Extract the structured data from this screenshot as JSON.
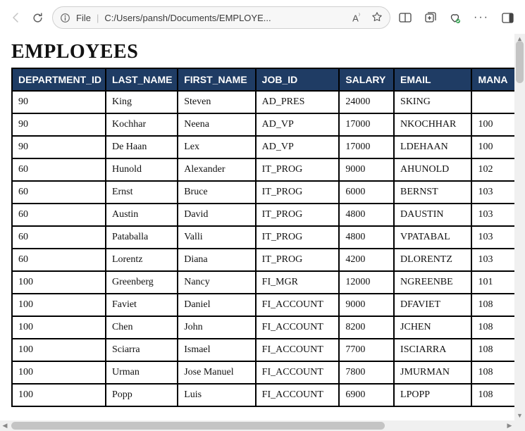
{
  "addressbar": {
    "scheme": "File",
    "url": "C:/Users/pansh/Documents/EMPLOYE...",
    "read_aloud": "A⁾"
  },
  "page": {
    "title": "EMPLOYEES"
  },
  "table": {
    "columns": [
      "DEPARTMENT_ID",
      "LAST_NAME",
      "FIRST_NAME",
      "JOB_ID",
      "SALARY",
      "EMAIL",
      "MANAGER_ID"
    ],
    "columns_cut": [
      "DEPARTMENT_ID",
      "LAST_NAME",
      "FIRST_NAME",
      "JOB_ID",
      "SALARY",
      "EMAIL",
      "MANA"
    ],
    "rows": [
      {
        "department_id": "90",
        "last_name": "King",
        "first_name": "Steven",
        "job_id": "AD_PRES",
        "salary": "24000",
        "email": "SKING",
        "manager_id": ""
      },
      {
        "department_id": "90",
        "last_name": "Kochhar",
        "first_name": "Neena",
        "job_id": "AD_VP",
        "salary": "17000",
        "email": "NKOCHHAR",
        "manager_id": "100"
      },
      {
        "department_id": "90",
        "last_name": "De Haan",
        "first_name": "Lex",
        "job_id": "AD_VP",
        "salary": "17000",
        "email": "LDEHAAN",
        "manager_id": "100"
      },
      {
        "department_id": "60",
        "last_name": "Hunold",
        "first_name": "Alexander",
        "job_id": "IT_PROG",
        "salary": "9000",
        "email": "AHUNOLD",
        "manager_id": "102"
      },
      {
        "department_id": "60",
        "last_name": "Ernst",
        "first_name": "Bruce",
        "job_id": "IT_PROG",
        "salary": "6000",
        "email": "BERNST",
        "manager_id": "103"
      },
      {
        "department_id": "60",
        "last_name": "Austin",
        "first_name": "David",
        "job_id": "IT_PROG",
        "salary": "4800",
        "email": "DAUSTIN",
        "manager_id": "103"
      },
      {
        "department_id": "60",
        "last_name": "Pataballa",
        "first_name": "Valli",
        "job_id": "IT_PROG",
        "salary": "4800",
        "email": "VPATABAL",
        "manager_id": "103"
      },
      {
        "department_id": "60",
        "last_name": "Lorentz",
        "first_name": "Diana",
        "job_id": "IT_PROG",
        "salary": "4200",
        "email": "DLORENTZ",
        "manager_id": "103"
      },
      {
        "department_id": "100",
        "last_name": "Greenberg",
        "first_name": "Nancy",
        "job_id": "FI_MGR",
        "salary": "12000",
        "email": "NGREENBE",
        "manager_id": "101"
      },
      {
        "department_id": "100",
        "last_name": "Faviet",
        "first_name": "Daniel",
        "job_id": "FI_ACCOUNT",
        "salary": "9000",
        "email": "DFAVIET",
        "manager_id": "108"
      },
      {
        "department_id": "100",
        "last_name": "Chen",
        "first_name": "John",
        "job_id": "FI_ACCOUNT",
        "salary": "8200",
        "email": "JCHEN",
        "manager_id": "108"
      },
      {
        "department_id": "100",
        "last_name": "Sciarra",
        "first_name": "Ismael",
        "job_id": "FI_ACCOUNT",
        "salary": "7700",
        "email": "ISCIARRA",
        "manager_id": "108"
      },
      {
        "department_id": "100",
        "last_name": "Urman",
        "first_name": "Jose Manuel",
        "job_id": "FI_ACCOUNT",
        "salary": "7800",
        "email": "JMURMAN",
        "manager_id": "108"
      },
      {
        "department_id": "100",
        "last_name": "Popp",
        "first_name": "Luis",
        "job_id": "FI_ACCOUNT",
        "salary": "6900",
        "email": "LPOPP",
        "manager_id": "108"
      }
    ]
  }
}
